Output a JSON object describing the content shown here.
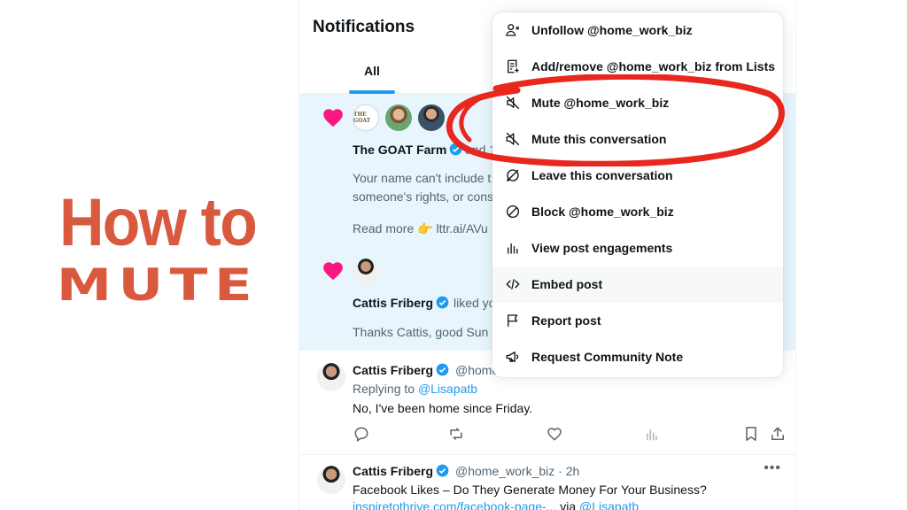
{
  "promo": {
    "line1": "How to",
    "line2": "MUTE"
  },
  "header": {
    "title": "Notifications",
    "tabs": [
      {
        "label": "All",
        "active": true
      }
    ]
  },
  "notifications": [
    {
      "type": "like",
      "avatar_text": "THE GOAT",
      "actor": "The GOAT Farm",
      "action_fragment": "and 1",
      "preview_line1": "Your name can't include t",
      "preview_line2": "someone's rights, or cons",
      "read_more_prefix": "Read more",
      "read_more_emoji": "👉",
      "read_more_link": "lttr.ai/AVu"
    },
    {
      "type": "like",
      "actor": "Cattis Friberg",
      "action_fragment": "liked yo",
      "preview": "Thanks Cattis, good Sun"
    }
  ],
  "tweets": [
    {
      "author": "Cattis Friberg",
      "handle_fragment": "@home",
      "replying_prefix": "Replying to",
      "replying_to": "@Lisapatb",
      "text": "No, I've been home since Friday."
    },
    {
      "author": "Cattis Friberg",
      "handle_time": "@home_work_biz · 2h",
      "text": "Facebook Likes – Do They Generate Money For Your Business?",
      "link_text": "inspiretothrive.com/facebook-page-...",
      "via_prefix": "via",
      "via_handle": "@Lisapatb"
    }
  ],
  "menu": {
    "items": [
      {
        "icon": "unfollow-icon",
        "label": "Unfollow @home_work_biz"
      },
      {
        "icon": "list-add-icon",
        "label": "Add/remove @home_work_biz from Lists"
      },
      {
        "icon": "mute-icon",
        "label": "Mute @home_work_biz"
      },
      {
        "icon": "mute-conversation-icon",
        "label": "Mute this conversation"
      },
      {
        "icon": "leave-conversation-icon",
        "label": "Leave this conversation"
      },
      {
        "icon": "block-icon",
        "label": "Block @home_work_biz"
      },
      {
        "icon": "engagements-icon",
        "label": "View post engagements"
      },
      {
        "icon": "embed-icon",
        "label": "Embed post",
        "hovered": true
      },
      {
        "icon": "flag-icon",
        "label": "Report post"
      },
      {
        "icon": "megaphone-icon",
        "label": "Request Community Note"
      }
    ]
  },
  "colors": {
    "accent": "#1d9bf0",
    "heart": "#f91880",
    "promo": "#d9593f",
    "annotation": "#e8271f",
    "highlight_bg": "#e8f5fd"
  }
}
